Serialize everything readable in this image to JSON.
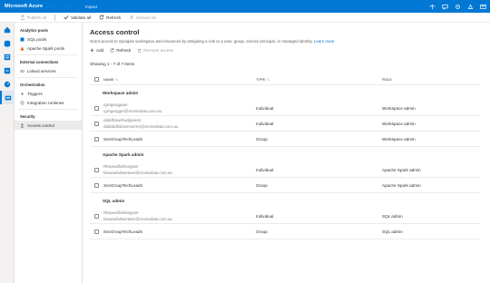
{
  "topbar": {
    "brand": "Microsoft Azure",
    "workspace": "· · · · · ·",
    "breadcrumb": "Impact",
    "icons": [
      "sync-icon",
      "feedback-icon",
      "settings-icon",
      "help-icon",
      "account-icon"
    ]
  },
  "commands": [
    {
      "label": "Publish all",
      "icon": "publish-icon",
      "disabled": true
    },
    {
      "label": "Validate all",
      "icon": "validate-icon",
      "disabled": false
    },
    {
      "label": "Refresh",
      "icon": "refresh-icon",
      "disabled": false
    },
    {
      "label": "Discard all",
      "icon": "discard-icon",
      "disabled": true
    }
  ],
  "subnav": {
    "sections": [
      {
        "title": "Analytics pools",
        "items": [
          {
            "label": "SQL pools",
            "icon": "sql-pool-icon"
          },
          {
            "label": "Apache Spark pools",
            "icon": "spark-pool-icon"
          }
        ]
      },
      {
        "title": "External connections",
        "items": [
          {
            "label": "Linked services",
            "icon": "linked-service-icon"
          }
        ]
      },
      {
        "title": "Orchestration",
        "items": [
          {
            "label": "Triggers",
            "icon": "trigger-icon"
          },
          {
            "label": "Integration runtimes",
            "icon": "runtime-icon"
          }
        ]
      },
      {
        "title": "Security",
        "items": [
          {
            "label": "Access control",
            "icon": "access-control-icon",
            "active": true
          }
        ]
      }
    ]
  },
  "main": {
    "title": "Access control",
    "description": "Grant access to Synapse workspace and resources by assigning a role to a user, group, service principal, or managed identity.",
    "learn_more": "Learn more",
    "actions": {
      "add": "Add",
      "refresh": "Refresh",
      "remove": "Remove access"
    },
    "showing": "Showing 1 - 7 of 7 items",
    "columns": {
      "name": "NAME",
      "type": "TYPE",
      "role": "ROLE"
    }
  },
  "groups": [
    {
      "label": "Workspace admin",
      "rows": [
        {
          "name1": "rgregerggepe",
          "name2": "rgregergger@morsedata.com.au",
          "type": "Individual",
          "role": "Workspace admin"
        },
        {
          "name1": "ddddfdwwhwdgwerer",
          "name2": "ddddddfwbwerwerrer@morsedata.com.au",
          "type": "Individual",
          "role": "Workspace admin"
        },
        {
          "name1": "SecGroupTechLeads",
          "name2": "",
          "type": "Group",
          "role": "Workspace admin"
        }
      ]
    },
    {
      "label": "Apache Spark admin",
      "rows": [
        {
          "name1": "Rbwwwfbwfwegwer",
          "name2": "fwwwwfwbwetwer@morsedata.com.au",
          "type": "Individual",
          "role": "Apache Spark admin"
        },
        {
          "name1": "SecGroupTechLeads",
          "name2": "",
          "type": "Group",
          "role": "Apache Spark admin"
        }
      ]
    },
    {
      "label": "SQL admin",
      "rows": [
        {
          "name1": "Rbwwwfbwfwegwer",
          "name2": "fwwwwfwbwetwer@morsedata.com.au",
          "type": "Individual",
          "role": "SQL admin"
        },
        {
          "name1": "SecGroupTechLeads",
          "name2": "",
          "type": "Group",
          "role": "SQL admin"
        }
      ]
    }
  ]
}
